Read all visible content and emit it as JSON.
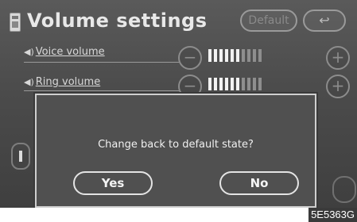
{
  "header": {
    "title": "Volume settings",
    "default_label": "Default",
    "back_glyph": "↩"
  },
  "rows": [
    {
      "label": "Voice volume",
      "icon": "speaker-icon",
      "minus": "−",
      "plus": "+",
      "level": 6,
      "max": 10
    },
    {
      "label": "Ring volume",
      "icon": "speaker-icon",
      "minus": "−",
      "plus": "+",
      "level": 6,
      "max": 10
    }
  ],
  "dialog": {
    "message": "Change back to default state?",
    "yes_label": "Yes",
    "no_label": "No"
  },
  "footer": {
    "code": "5E5363G"
  }
}
